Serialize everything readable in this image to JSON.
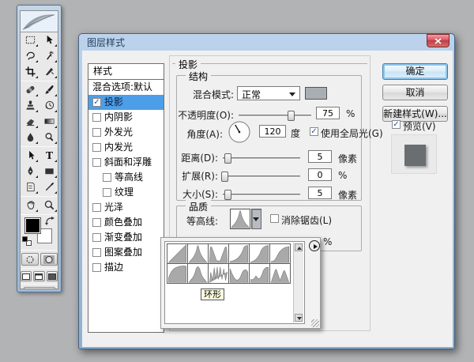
{
  "toolbar": {
    "tools": [
      "rectangular-marquee",
      "move",
      "lasso",
      "magic-wand",
      "crop",
      "slice",
      "healing-brush",
      "brush",
      "clone-stamp",
      "history-brush",
      "eraser",
      "gradient",
      "blur",
      "dodge",
      "path-selection",
      "type",
      "pen",
      "shape",
      "notes",
      "eyedropper",
      "hand",
      "zoom"
    ]
  },
  "dialog": {
    "title": "图层样式",
    "styles_panel": {
      "header": "样式",
      "items": [
        {
          "label": "混合选项:默认",
          "checkbox": false,
          "checked": false,
          "selected": false,
          "indent": false
        },
        {
          "label": "投影",
          "checkbox": true,
          "checked": true,
          "selected": true,
          "indent": false
        },
        {
          "label": "内阴影",
          "checkbox": true,
          "checked": false,
          "selected": false,
          "indent": false
        },
        {
          "label": "外发光",
          "checkbox": true,
          "checked": false,
          "selected": false,
          "indent": false
        },
        {
          "label": "内发光",
          "checkbox": true,
          "checked": false,
          "selected": false,
          "indent": false
        },
        {
          "label": "斜面和浮雕",
          "checkbox": true,
          "checked": false,
          "selected": false,
          "indent": false
        },
        {
          "label": "等高线",
          "checkbox": true,
          "checked": false,
          "selected": false,
          "indent": true
        },
        {
          "label": "纹理",
          "checkbox": true,
          "checked": false,
          "selected": false,
          "indent": true
        },
        {
          "label": "光泽",
          "checkbox": true,
          "checked": false,
          "selected": false,
          "indent": false
        },
        {
          "label": "颜色叠加",
          "checkbox": true,
          "checked": false,
          "selected": false,
          "indent": false
        },
        {
          "label": "渐变叠加",
          "checkbox": true,
          "checked": false,
          "selected": false,
          "indent": false
        },
        {
          "label": "图案叠加",
          "checkbox": true,
          "checked": false,
          "selected": false,
          "indent": false
        },
        {
          "label": "描边",
          "checkbox": true,
          "checked": false,
          "selected": false,
          "indent": false
        }
      ]
    },
    "shadow_page": {
      "title": "投影",
      "structure": {
        "title": "结构",
        "blend_mode_label": "混合模式:",
        "blend_mode_value": "正常",
        "opacity_label": "不透明度(O):",
        "opacity_value": "75",
        "opacity_unit": "%",
        "angle_label": "角度(A):",
        "angle_value": "120",
        "angle_unit": "度",
        "use_global_light_label": "使用全局光(G)",
        "use_global_light_checked": true,
        "distance_label": "距离(D):",
        "distance_value": "5",
        "distance_unit": "像素",
        "spread_label": "扩展(R):",
        "spread_value": "0",
        "spread_unit": "%",
        "size_label": "大小(S):",
        "size_value": "5",
        "size_unit": "像素"
      },
      "quality": {
        "title": "品质",
        "contour_label": "等高线:",
        "antialias_label": "消除锯齿(L)",
        "antialias_checked": false,
        "noise_unit": "%"
      }
    },
    "buttons": {
      "ok": "确定",
      "cancel": "取消",
      "new_style": "新建样式(W)...",
      "preview_label": "预览(V)",
      "preview_checked": true
    },
    "contour_popup": {
      "tooltip": "环形",
      "thumbnails": [
        "linear",
        "cone",
        "cone-inverted",
        "cove-deep",
        "cove-shallow",
        "gaussian",
        "half-round",
        "ring",
        "triple-ring",
        "wave",
        "rolling-slope",
        "two-peaks"
      ]
    },
    "colors": {
      "selection": "#4d9ee8",
      "shadow_color_swatch": "#a9aeb3",
      "preview_square": "#6a6e71"
    }
  }
}
